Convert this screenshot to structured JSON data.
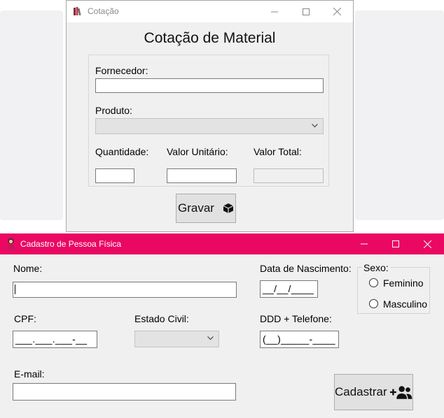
{
  "cotacao_window": {
    "title": "Cotação",
    "heading": "Cotação de Material",
    "fornecedor_label": "Fornecedor:",
    "fornecedor_value": "",
    "produto_label": "Produto:",
    "produto_value": "",
    "quantidade_label": "Quantidade:",
    "valor_unitario_label": "Valor Unitário:",
    "valor_total_label": "Valor Total:",
    "gravar_label": "Gravar"
  },
  "cadastro_window": {
    "title": "Cadastro de Pessoa Física",
    "titlebar_color": "#ea0863",
    "nome_label": "Nome:",
    "data_nascimento_label": "Data de Nascimento:",
    "data_nascimento_mask": "__/__/____",
    "sexo_label": "Sexo:",
    "sexo_options": [
      "Feminino",
      "Masculino"
    ],
    "cpf_label": "CPF:",
    "cpf_mask": "___.___.___-__",
    "estado_civil_label": "Estado Civil:",
    "ddd_telefone_label": "DDD + Telefone:",
    "telefone_mask": "(__)_____-____",
    "email_label": "E-mail:",
    "cadastrar_label": "Cadastrar"
  },
  "icons": {
    "cotacao_app": "books-icon",
    "gravar": "cube-icon",
    "cadastro_app": "person-icon",
    "cadastrar": "add-user-icon",
    "window_controls": [
      "minimize-icon",
      "maximize-icon",
      "close-icon"
    ]
  }
}
